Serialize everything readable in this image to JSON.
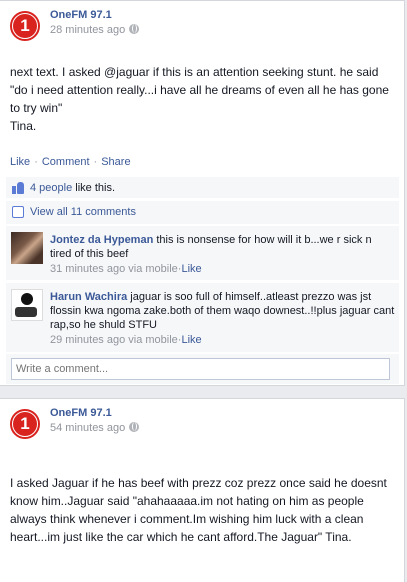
{
  "post1": {
    "page_name": "OneFM 97.1",
    "logo_text": "1",
    "timestamp": "28 minutes ago",
    "body": "next text. I asked @jaguar if this is an attention seeking stunt. he said \"do i need attention really...i have all he dreams of even all he has gone to try win\"\nTina.",
    "actions": {
      "like": "Like",
      "comment": "Comment",
      "share": "Share",
      "separator": "·"
    },
    "likes": {
      "count_link": "4 people",
      "suffix": " like this."
    },
    "view_comments": "View all 11 comments",
    "comments": [
      {
        "author": "Jontez da Hypeman",
        "text": "this is nonsense for how will it b...we r sick n tired of this beef",
        "time": "31 minutes ago via mobile",
        "like": "Like"
      },
      {
        "author": "Harun Wachira",
        "text": "jaguar is soo full of himself..atleast prezzo was jst flossin kwa ngoma zake.both of them waqo downest..!!plus jaguar cant rap,so he shuld STFU",
        "time": "29 minutes ago via mobile",
        "like": "Like"
      }
    ],
    "comment_placeholder": "Write a comment..."
  },
  "post2": {
    "page_name": "OneFM 97.1",
    "logo_text": "1",
    "timestamp": "54 minutes ago",
    "body": "I asked Jaguar if he has beef with prezz coz prezz once said he doesnt know him..Jaguar said \"ahahaaaaa.im not hating on him as people always think whenever i comment.Im wishing him luck with a clean heart...im just like the car which he cant afford.The Jaguar\" Tina."
  },
  "colors": {
    "link": "#3b5998",
    "brand_red": "#d9231f",
    "meta": "#90949c",
    "panel": "#f6f7f9"
  }
}
